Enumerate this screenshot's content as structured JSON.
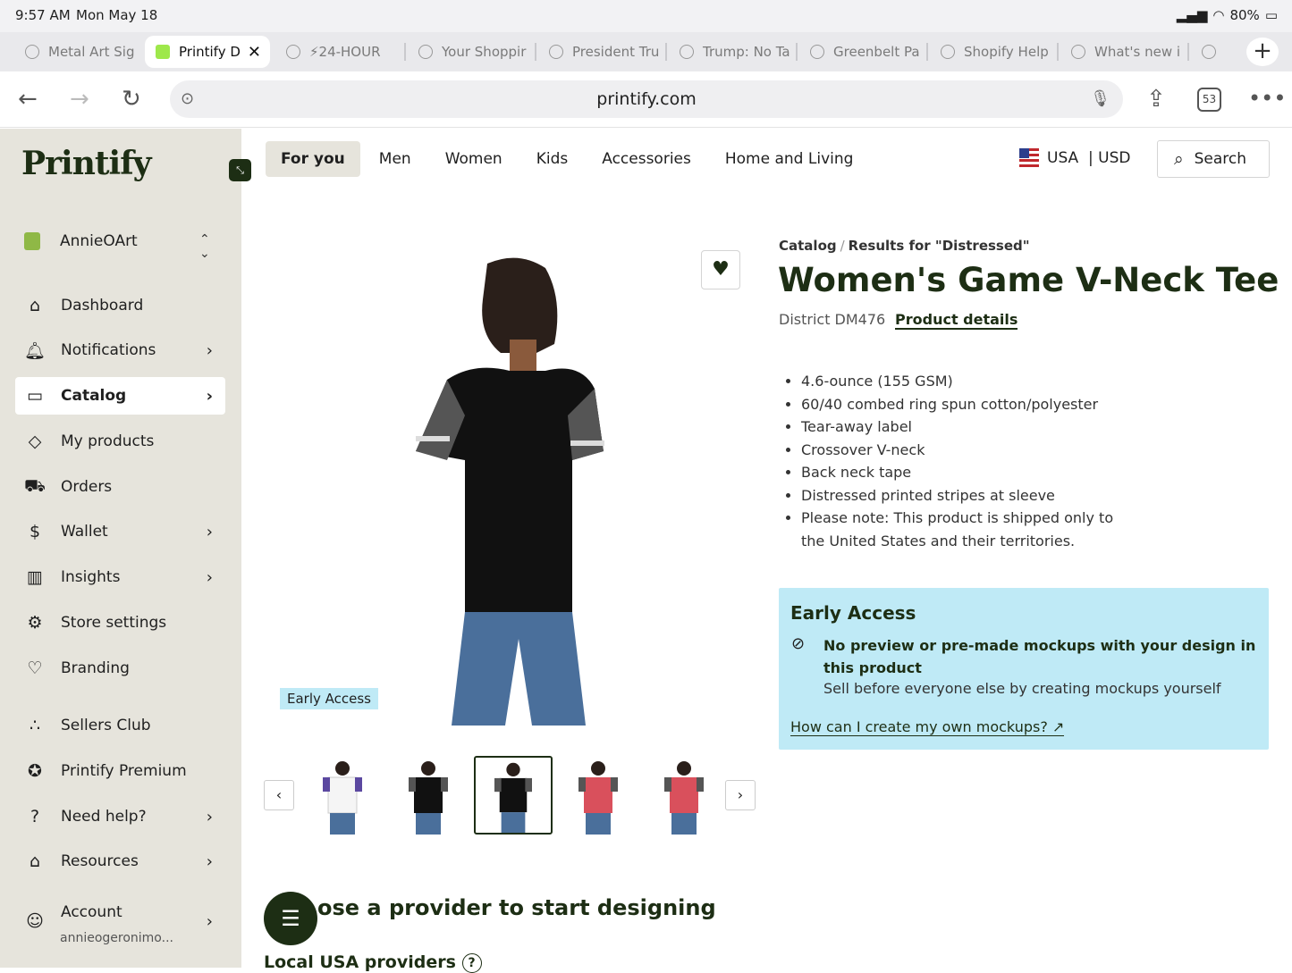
{
  "status": {
    "time": "9:57 AM",
    "date": "Mon May 18",
    "battery": "80%"
  },
  "tabs": [
    {
      "label": "Metal Art Sig"
    },
    {
      "label": "Printify D"
    },
    {
      "label": "⚡24-HOUR"
    },
    {
      "label": "Your Shoppir"
    },
    {
      "label": "President Tru"
    },
    {
      "label": "Trump: No Ta"
    },
    {
      "label": "Greenbelt Pa"
    },
    {
      "label": "Shopify Help"
    },
    {
      "label": "What's new i"
    }
  ],
  "browser": {
    "url": "printify.com",
    "tab_count": "53"
  },
  "sidebar": {
    "logo": "Printify",
    "store_name": "AnnieOArt",
    "items": [
      {
        "label": "Dashboard",
        "icon": "home-icon"
      },
      {
        "label": "Notifications",
        "icon": "bell-icon"
      },
      {
        "label": "Catalog",
        "icon": "clipboard-icon"
      },
      {
        "label": "My products",
        "icon": "tag-icon"
      },
      {
        "label": "Orders",
        "icon": "truck-icon"
      },
      {
        "label": "Wallet",
        "icon": "dollar-icon"
      },
      {
        "label": "Insights",
        "icon": "chart-icon"
      },
      {
        "label": "Store settings",
        "icon": "gear-icon"
      },
      {
        "label": "Branding",
        "icon": "heart-icon"
      },
      {
        "label": "Sellers Club",
        "icon": "dots-icon"
      },
      {
        "label": "Printify Premium",
        "icon": "badge-icon"
      },
      {
        "label": "Need help?",
        "icon": "help-icon"
      },
      {
        "label": "Resources",
        "icon": "cap-icon"
      },
      {
        "label": "Account",
        "icon": "user-icon"
      }
    ],
    "account_email": "annieogeronimo..."
  },
  "topnav": {
    "items": [
      "For you",
      "Men",
      "Women",
      "Kids",
      "Accessories",
      "Home and Living"
    ],
    "country": "USA",
    "currency": "| USD",
    "search_label": "Search"
  },
  "product": {
    "breadcrumb_root": "Catalog",
    "breadcrumb_leaf": "Results for \"Distressed\"",
    "title": "Women's Game V-Neck Tee",
    "sku": "District DM476",
    "details_link": "Product details",
    "features": [
      "4.6-ounce (155 GSM)",
      "60/40 combed ring spun cotton/polyester",
      "Tear-away label",
      "Crossover V-neck",
      "Back neck tape",
      "Distressed printed stripes at sleeve",
      "Please note: This product is shipped only to the United States and their territories."
    ],
    "image_tag": "Early Access"
  },
  "early_access": {
    "title": "Early Access",
    "warning": "No preview or pre-made mockups with your design in this product",
    "subtext": "Sell before everyone else by creating mockups yourself",
    "link": "How can I create my own mockups?"
  },
  "sections": {
    "provider_heading": "ose a provider to start designing",
    "local_heading": "Local USA providers"
  },
  "colors": {
    "brand_dark": "#1d2e14",
    "early_access_bg": "#bfeaf6",
    "sidebar_bg": "#e6e4dc"
  }
}
